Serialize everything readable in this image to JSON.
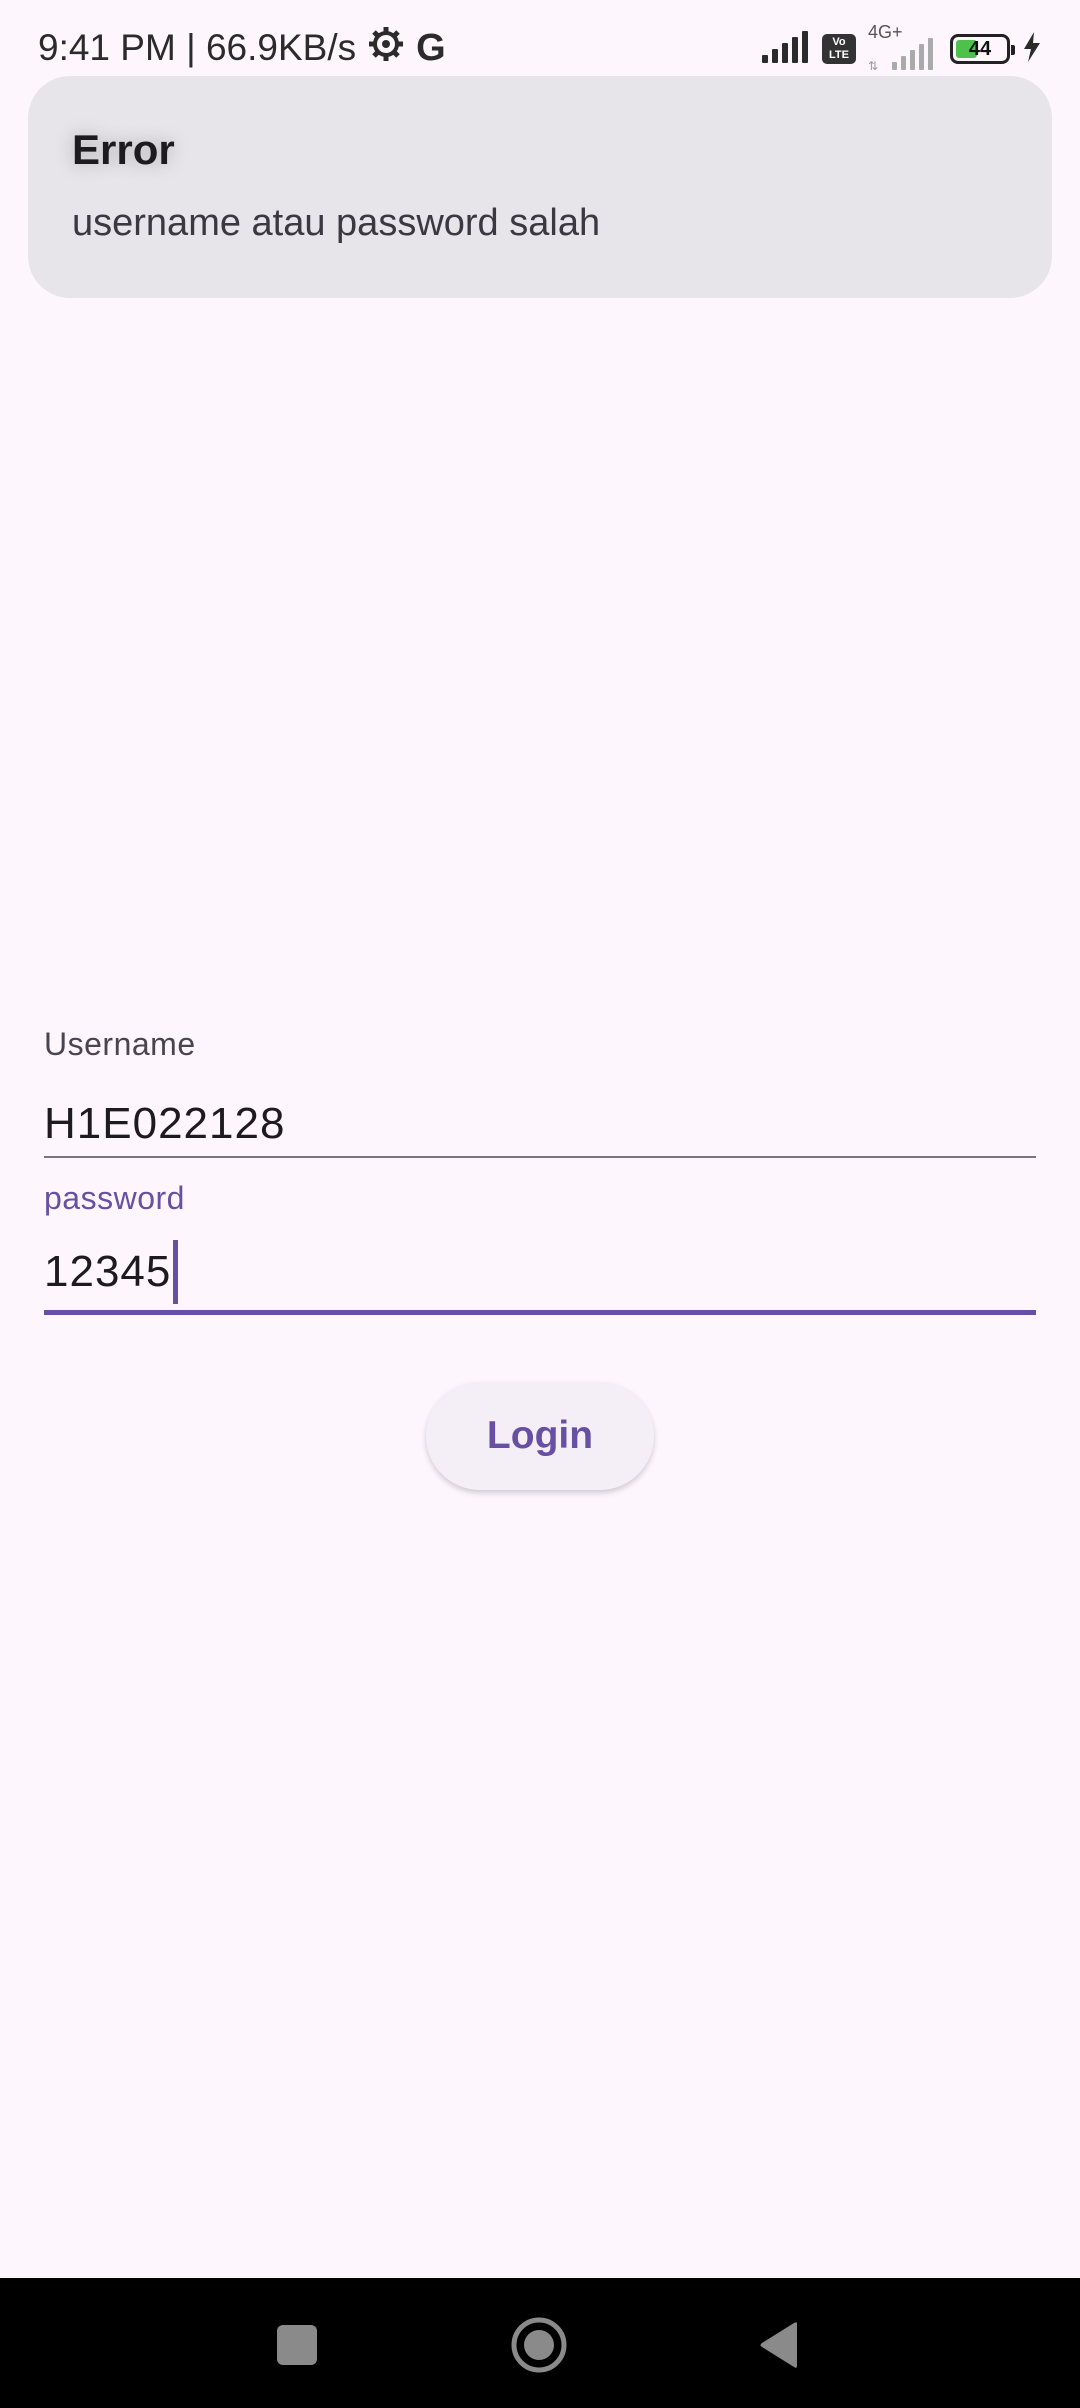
{
  "status_bar": {
    "time_speed": "9:41 PM | 66.9KB/s",
    "google_glyph": "G",
    "network_type": "4G+",
    "volte_line1": "Vo",
    "volte_line2": "LTE",
    "battery_level": "44",
    "battery_fraction": 0.44,
    "icons": [
      "gear-icon",
      "google-icon",
      "signal-icon",
      "volte-icon",
      "signal-weak-icon",
      "battery-icon",
      "charging-icon"
    ]
  },
  "error_banner": {
    "title": "Error",
    "message": "username atau password salah"
  },
  "form": {
    "username": {
      "label": "Username",
      "value": "H1E022128"
    },
    "password": {
      "label": "password",
      "value": "12345"
    },
    "login_label": "Login"
  },
  "nav_bar": {
    "icons": [
      "recents-square-icon",
      "home-circle-icon",
      "back-triangle-icon"
    ]
  },
  "colors": {
    "background": "#fdf7fd",
    "accent": "#6750a4",
    "banner": "#e8e5ea",
    "label_gray": "#49454f"
  }
}
